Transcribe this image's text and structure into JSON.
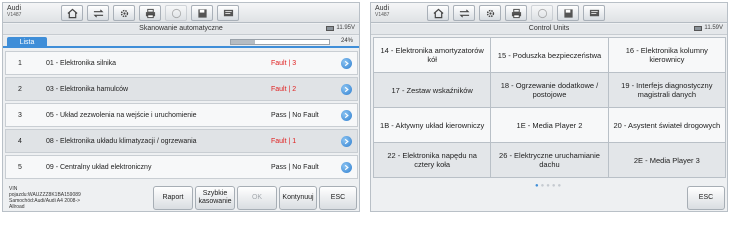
{
  "left": {
    "brand": "Audi",
    "vin_short": "V1487",
    "toolbar_icons": [
      "home-icon",
      "car-swap-icon",
      "settings-icon",
      "print-icon",
      "help-icon",
      "save-icon",
      "data-icon"
    ],
    "title": "Skanowanie automatyczne",
    "battery": "11.95V",
    "tab": "Lista",
    "progress_text": "24%",
    "progress_value": 0.24,
    "rows": [
      {
        "num": "1",
        "name": "01 - Elektronika silnika",
        "status": "Fault | 3",
        "fault": true
      },
      {
        "num": "2",
        "name": "03 - Elektronika hamulców",
        "status": "Fault | 2",
        "fault": true
      },
      {
        "num": "3",
        "name": "05 - Układ zezwolenia na wejście i uruchomienie",
        "status": "Pass | No Fault",
        "fault": false
      },
      {
        "num": "4",
        "name": "08 - Elektronika układu klimatyzacji / ogrzewania",
        "status": "Fault | 1",
        "fault": true
      },
      {
        "num": "5",
        "name": "09 - Centralny układ elektroniczny",
        "status": "Pass | No Fault",
        "fault": false
      }
    ],
    "vehicle_info": [
      "VIN",
      "pojazdu:WAUZZZ8K1BA159089",
      "Samochód:Audi/Audi A4 2008->",
      "Allroad"
    ],
    "buttons": {
      "raport": "Raport",
      "quick_erase": "Szybkie kasowanie",
      "ok": "OK",
      "continue": "Kontynuuj",
      "esc": "ESC"
    }
  },
  "right": {
    "brand": "Audi",
    "vin_short": "V1487",
    "title": "Control Units",
    "battery": "11.59V",
    "units": [
      "14 - Elektronika amortyzatorów kół",
      "15 - Poduszka bezpieczeństwa",
      "16 - Elektronika kolumny kierownicy",
      "17 - Zestaw wskaźników",
      "18 - Ogrzewanie dodatkowe / postojowe",
      "19 - Interfejs diagnostyczny magistrali danych",
      "1B - Aktywny układ kierowniczy",
      "1E - Media Player 2",
      "20 - Asystent świateł drogowych",
      "22 - Elektronika napędu na cztery koła",
      "26 - Elektryczne uruchamianie dachu",
      "2E - Media Player 3"
    ],
    "page_dots": 5,
    "active_dot": 0,
    "esc": "ESC"
  },
  "colors": {
    "accent": "#3f8ed8",
    "fault": "#e02020"
  }
}
